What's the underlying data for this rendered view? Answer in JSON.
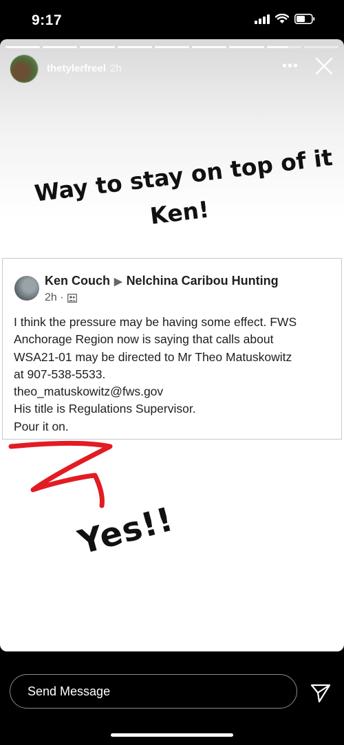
{
  "status_bar": {
    "time": "9:17"
  },
  "story": {
    "progress": {
      "segments_total": 9,
      "segments_complete": 7
    },
    "username": "thetylerfreel",
    "age": "2h",
    "more_label": "•••",
    "headline_line1": "Way to stay on top of it",
    "headline_line2": "Ken!",
    "reaction": "Yes!!",
    "scribble_color": "#e31b23"
  },
  "post": {
    "author": "Ken Couch",
    "arrow": "▶",
    "group": "Nelchina Caribou Hunting",
    "time": "2h ·",
    "lines": [
      "I think the pressure may be having some effect.  FWS",
      "Anchorage Region now is saying that calls about",
      "WSA21-01 may be directed to Mr Theo Matuskowitz",
      "at 907-538-5533.",
      "theo_matuskowitz@fws.gov",
      "His title is Regulations Supervisor.",
      "Pour it on."
    ]
  },
  "footer": {
    "message_placeholder": "Send Message"
  }
}
